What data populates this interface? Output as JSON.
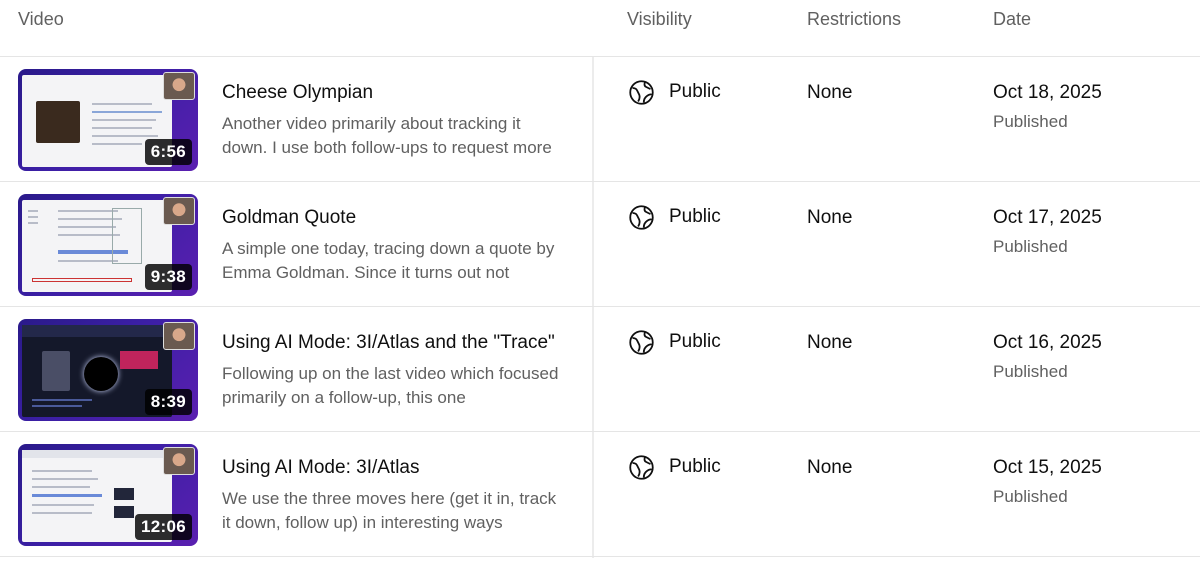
{
  "header": {
    "video": "Video",
    "visibility": "Visibility",
    "restrictions": "Restrictions",
    "date": "Date"
  },
  "videos": [
    {
      "title": "Cheese Olympian",
      "description": "Another video primarily about tracking it down. I use both follow-ups to request more",
      "duration": "6:56",
      "visibility": "Public",
      "visibility_icon": "globe-icon",
      "restrictions": "None",
      "date": "Oct 18, 2025",
      "status": "Published"
    },
    {
      "title": "Goldman Quote",
      "description": "A simple one today, tracing down a quote by Emma Goldman. Since it turns out not",
      "duration": "9:38",
      "visibility": "Public",
      "visibility_icon": "globe-icon",
      "restrictions": "None",
      "date": "Oct 17, 2025",
      "status": "Published"
    },
    {
      "title": "Using AI Mode: 3I/Atlas and the \"Trace\"",
      "description": "Following up on the last video which focused primarily on a follow-up, this one",
      "duration": "8:39",
      "visibility": "Public",
      "visibility_icon": "globe-icon",
      "restrictions": "None",
      "date": "Oct 16, 2025",
      "status": "Published"
    },
    {
      "title": "Using AI Mode: 3I/Atlas",
      "description": "We use the three moves here (get it in, track it down, follow up) in interesting ways",
      "duration": "12:06",
      "visibility": "Public",
      "visibility_icon": "globe-icon",
      "restrictions": "None",
      "date": "Oct 15, 2025",
      "status": "Published"
    }
  ]
}
